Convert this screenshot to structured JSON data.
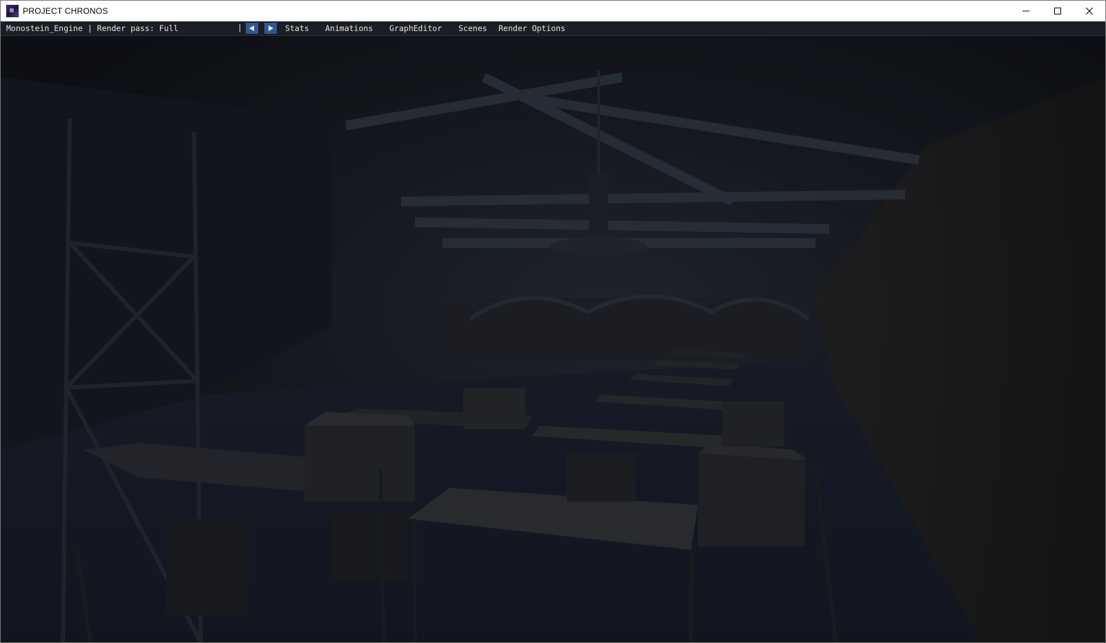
{
  "window": {
    "title": "PROJECT CHRONOS",
    "controls": {
      "minimize": "minimize-icon",
      "maximize": "maximize-icon",
      "close": "close-icon"
    }
  },
  "menubar": {
    "engine_label": "Monostein_Engine | Render pass: Full",
    "separator": "|",
    "prev_icon": "triangle-left-icon",
    "next_icon": "triangle-right-icon",
    "items": [
      "Stats",
      "Animations",
      "GraphEditor",
      "Scenes",
      "Render Options"
    ]
  },
  "colors": {
    "menubar_bg": "#1b1e24",
    "nav_button": "#2f5a8f",
    "scene_bg": "#141820"
  }
}
